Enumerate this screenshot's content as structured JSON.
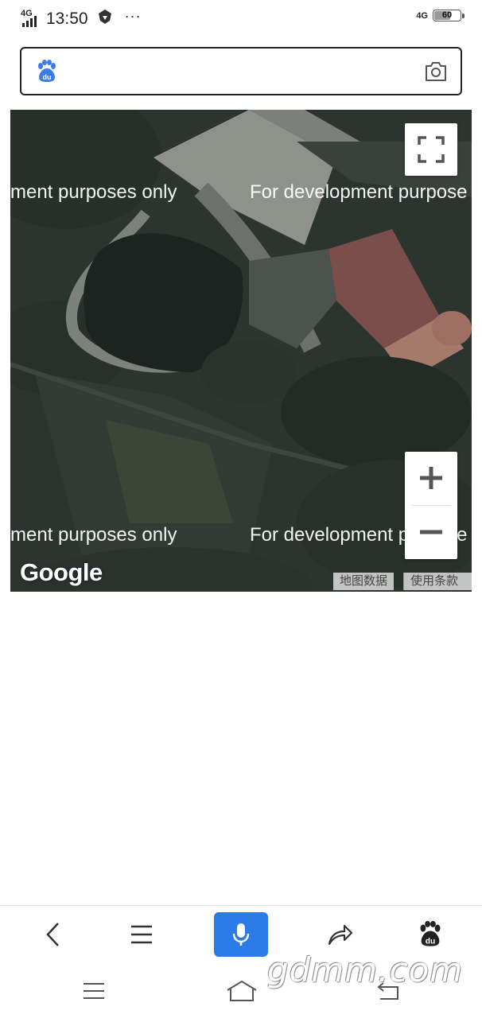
{
  "status_bar": {
    "network_left": "4G",
    "time": "13:50",
    "more": "···",
    "network_right": "4G",
    "battery_level": "60",
    "battery_fraction": 0.6
  },
  "search": {
    "placeholder": "",
    "value": "",
    "logo_icon": "baidu-paw-icon",
    "camera_icon": "camera-icon"
  },
  "map": {
    "watermark_top_left": "ment purposes only",
    "watermark_top_right": "For development purpose",
    "watermark_bottom_left": "ment purposes only",
    "watermark_bottom_right": "For development purpose",
    "brand": "Google",
    "attribution_map_data": "地图数据",
    "attribution_terms": "使用条款",
    "fullscreen_icon": "fullscreen-icon",
    "zoom_in_icon": "plus-icon",
    "zoom_out_icon": "minus-icon"
  },
  "toolbar": {
    "items": [
      {
        "icon": "back-chevron-icon"
      },
      {
        "icon": "menu-icon"
      },
      {
        "icon": "microphone-icon"
      },
      {
        "icon": "share-icon"
      },
      {
        "icon": "baidu-paw-icon"
      }
    ],
    "accent_color": "#2a7be8"
  },
  "navbar": {
    "items": [
      {
        "icon": "recent-apps-icon"
      },
      {
        "icon": "home-icon"
      },
      {
        "icon": "back-icon"
      }
    ]
  },
  "site_watermark": "gdmm.com"
}
